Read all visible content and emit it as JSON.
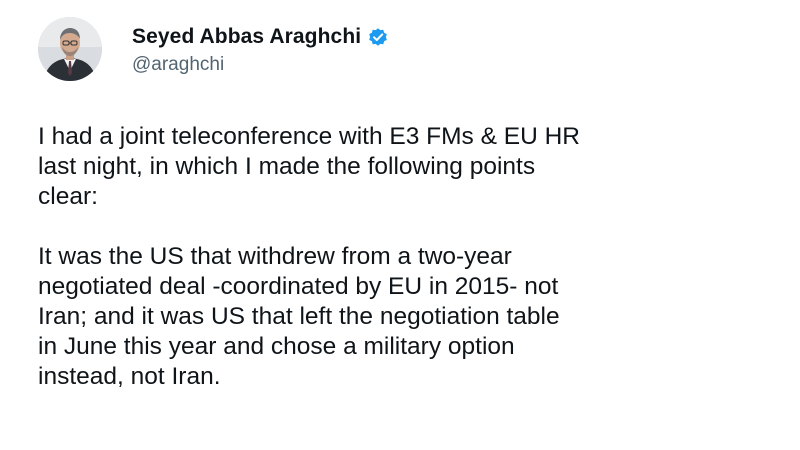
{
  "author": {
    "display_name": "Seyed Abbas Araghchi",
    "handle": "@araghchi",
    "verified_icon": "verified-badge-icon",
    "verified_color": "#1d9bf0"
  },
  "tweet": {
    "paragraph1": [
      "I had a joint teleconference with E3 FMs & EU HR",
      "last night, in which I made the following points",
      "clear:"
    ],
    "paragraph2": [
      "It was the US that withdrew from a two-year",
      "negotiated deal -coordinated by EU in 2015- not",
      "Iran; and it was US that left the negotiation table",
      "in June this year and chose a military option",
      "instead, not Iran."
    ]
  },
  "colors": {
    "text": "#0f1419",
    "secondary_text": "#536471",
    "background": "#ffffff"
  }
}
